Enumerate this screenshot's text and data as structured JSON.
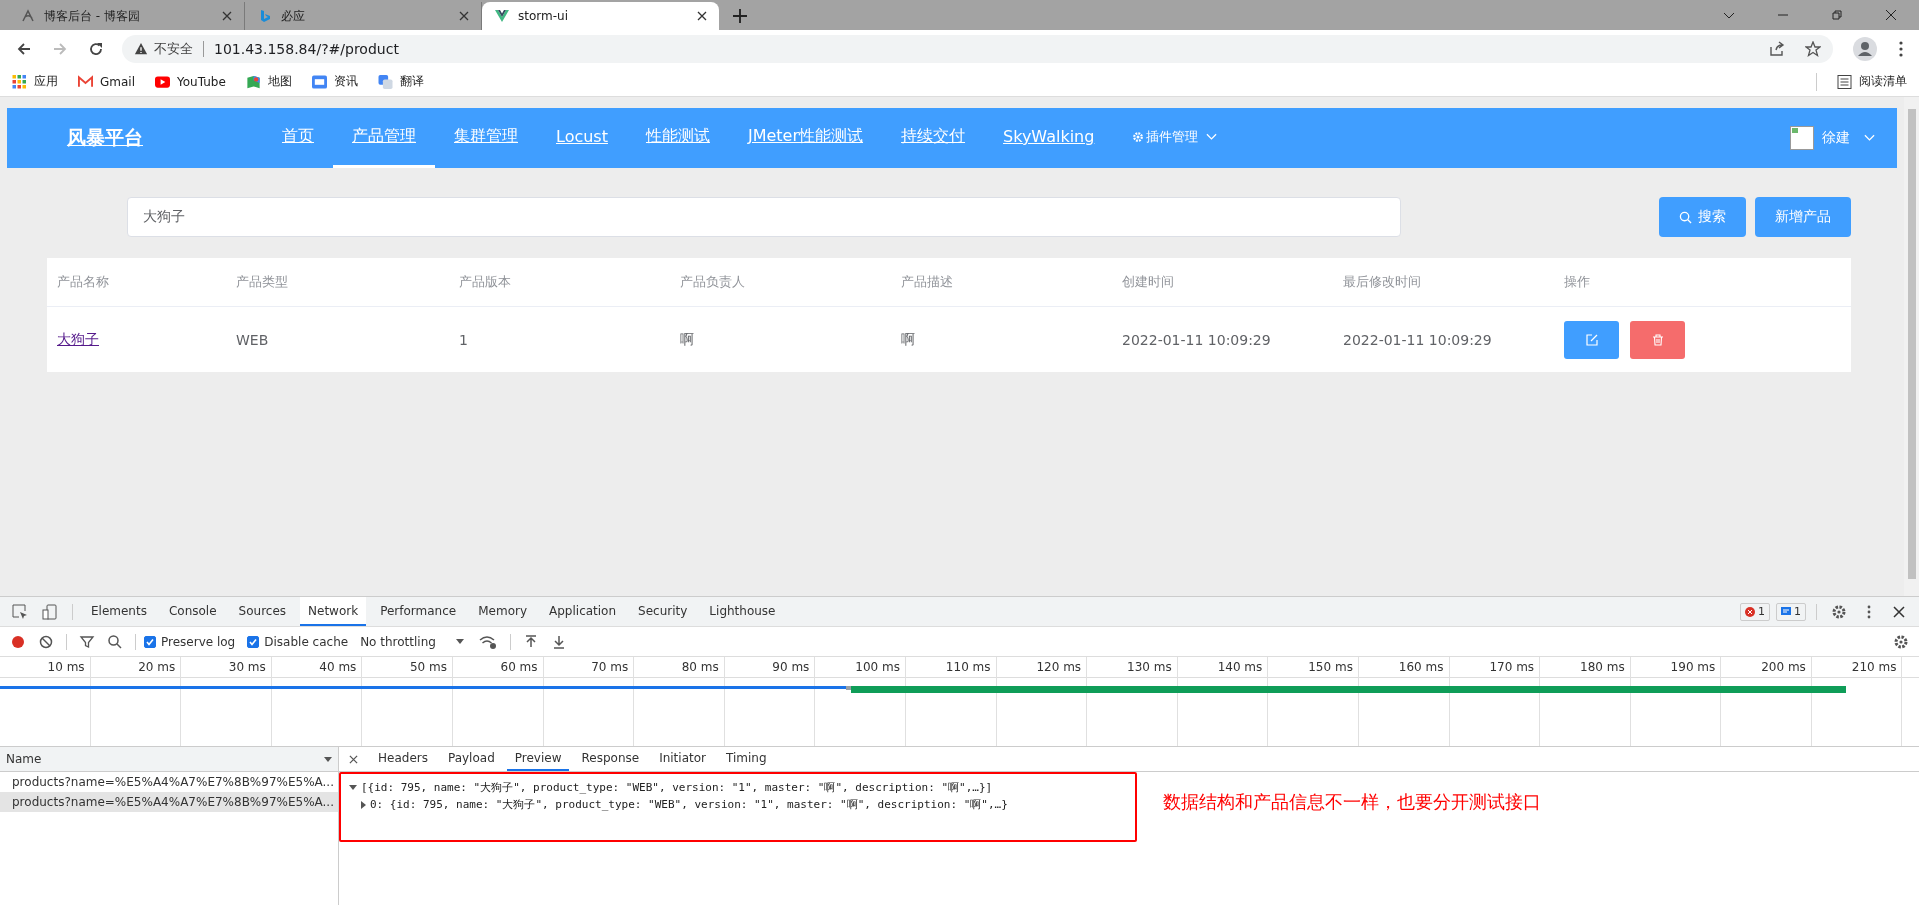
{
  "browser_tabs": [
    {
      "title": "博客后台 - 博客园",
      "selected": false,
      "kind": "blog"
    },
    {
      "title": "必应",
      "selected": false,
      "kind": "bing"
    },
    {
      "title": "storm-ui",
      "selected": true,
      "kind": "vue"
    }
  ],
  "address_bar": {
    "security": "不安全",
    "url": "101.43.158.84/?#/product"
  },
  "bookmarks": [
    {
      "label": "应用",
      "kind": "apps"
    },
    {
      "label": "Gmail",
      "kind": "mail"
    },
    {
      "label": "YouTube",
      "kind": "video"
    },
    {
      "label": "地图",
      "kind": "map"
    },
    {
      "label": "资讯",
      "kind": "news"
    },
    {
      "label": "翻译",
      "kind": "translate"
    }
  ],
  "reading_list": "阅读清单",
  "navbar": {
    "brand": "风暴平台",
    "items": [
      {
        "label": "首页",
        "selected": false,
        "kind": "link"
      },
      {
        "label": "产品管理",
        "selected": true,
        "kind": "link"
      },
      {
        "label": "集群管理",
        "selected": false,
        "kind": "link"
      },
      {
        "label": "Locust",
        "selected": false,
        "kind": "link"
      },
      {
        "label": "性能测试",
        "selected": false,
        "kind": "link"
      },
      {
        "label": "JMeter性能测试",
        "selected": false,
        "kind": "link"
      },
      {
        "label": "持续交付",
        "selected": false,
        "kind": "link"
      },
      {
        "label": "SkyWalking",
        "selected": false,
        "kind": "link"
      },
      {
        "label": "插件管理",
        "selected": false,
        "kind": "dropdown"
      }
    ],
    "user": "徐建"
  },
  "search": {
    "value": "大狗子"
  },
  "buttons": [
    {
      "label": "搜索",
      "kind": "search"
    },
    {
      "label": "新增产品",
      "kind": "plain"
    }
  ],
  "table": {
    "columns": [
      "产品名称",
      "产品类型",
      "产品版本",
      "产品负责人",
      "产品描述",
      "创建时间",
      "最后修改时间",
      "操作"
    ],
    "rows": [
      {
        "cells": [
          "大狗子",
          "WEB",
          "1",
          "啊",
          "啊",
          "2022-01-11 10:09:29",
          "2022-01-11 10:09:29"
        ]
      }
    ]
  },
  "devtools": {
    "tabs": [
      {
        "label": "Elements",
        "selected": false
      },
      {
        "label": "Console",
        "selected": false
      },
      {
        "label": "Sources",
        "selected": false
      },
      {
        "label": "Network",
        "selected": true
      },
      {
        "label": "Performance",
        "selected": false
      },
      {
        "label": "Memory",
        "selected": false
      },
      {
        "label": "Application",
        "selected": false
      },
      {
        "label": "Security",
        "selected": false
      },
      {
        "label": "Lighthouse",
        "selected": false
      }
    ],
    "errors": "1",
    "messages": "1",
    "recording": true,
    "options": [
      {
        "label": "Preserve log",
        "checked": true
      },
      {
        "label": "Disable cache",
        "checked": true
      }
    ],
    "throttling": "No throttling",
    "ticks": [
      "10 ms",
      "20 ms",
      "30 ms",
      "40 ms",
      "50 ms",
      "60 ms",
      "70 ms",
      "80 ms",
      "90 ms",
      "100 ms",
      "110 ms",
      "120 ms",
      "130 ms",
      "140 ms",
      "150 ms",
      "160 ms",
      "170 ms",
      "180 ms",
      "190 ms",
      "200 ms",
      "210 ms"
    ],
    "name_header": "Name",
    "requests": [
      {
        "name": "products?name=%E5%A4%A7%E7%8B%97%E5%A...",
        "selected": false
      },
      {
        "name": "products?name=%E5%A4%A7%E7%8B%97%E5%A...",
        "selected": true
      }
    ],
    "detail_tabs": [
      {
        "label": "Headers",
        "selected": false
      },
      {
        "label": "Payload",
        "selected": false
      },
      {
        "label": "Preview",
        "selected": true
      },
      {
        "label": "Response",
        "selected": false
      },
      {
        "label": "Initiator",
        "selected": false
      },
      {
        "label": "Timing",
        "selected": false
      }
    ],
    "preview": [
      {
        "text": "[{id: 795, name: \"大狗子\", product_type: \"WEB\", version: \"1\", master: \"啊\", description: \"啊\",…}]",
        "expanded": true
      },
      {
        "text": "0: {id: 795, name: \"大狗子\", product_type: \"WEB\", version: \"1\", master: \"啊\", description: \"啊\",…}",
        "expanded": false
      }
    ],
    "annotation": "数据结构和产品信息不一样，也要分开测试接口"
  }
}
